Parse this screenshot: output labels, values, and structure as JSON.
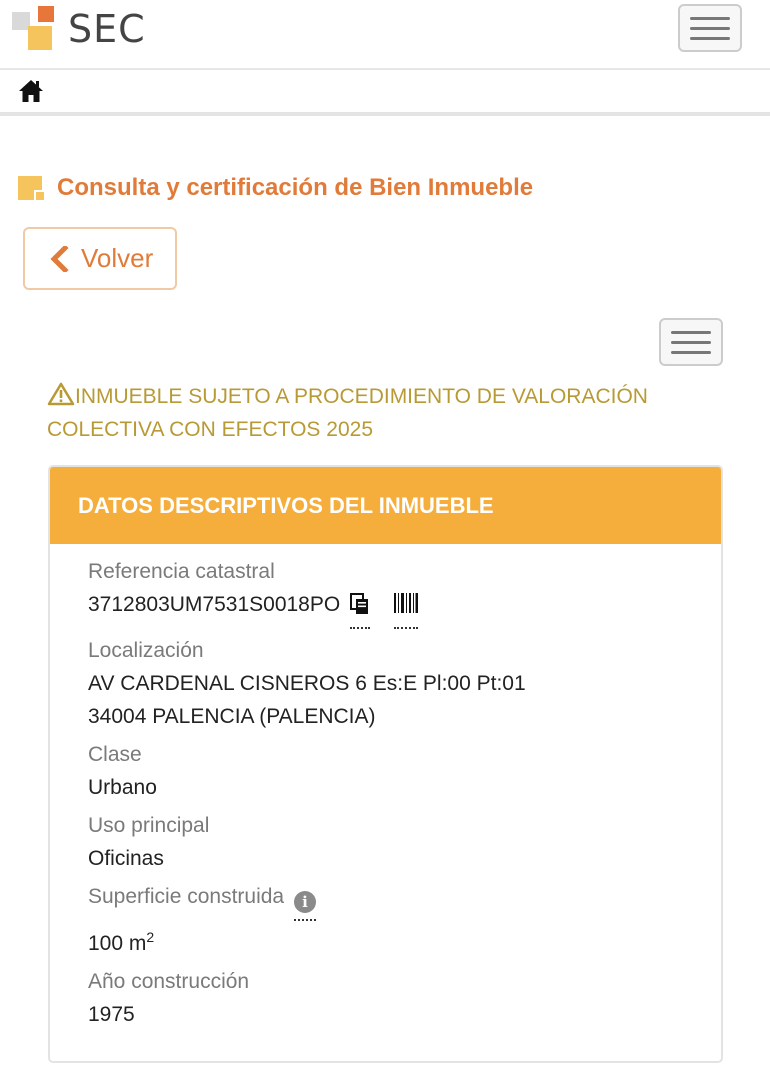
{
  "header": {
    "logo_text": "SEC",
    "menu_icon": "hamburger-icon"
  },
  "breadcrumb": {
    "home_icon": "home-icon"
  },
  "page": {
    "title": "Consulta y certificación de Bien Inmueble",
    "back_label": "Volver"
  },
  "warning": {
    "icon": "warning-triangle-icon",
    "text": "INMUEBLE SUJETO A PROCEDIMIENTO DE VALORACIÓN COLECTIVA CON EFECTOS 2025"
  },
  "panel": {
    "title": "DATOS DESCRIPTIVOS DEL INMUEBLE",
    "fields": {
      "referencia": {
        "label": "Referencia catastral",
        "value": "3712803UM7531S0018PO"
      },
      "localizacion": {
        "label": "Localización",
        "line1": "AV CARDENAL CISNEROS 6 Es:E Pl:00 Pt:01",
        "line2": "34004 PALENCIA (PALENCIA)"
      },
      "clase": {
        "label": "Clase",
        "value": "Urbano"
      },
      "uso": {
        "label": "Uso principal",
        "value": "Oficinas"
      },
      "superficie": {
        "label": "Superficie construida",
        "value": "100 m",
        "unit_sup": "2",
        "info_glyph": "i"
      },
      "anio": {
        "label": "Año construcción",
        "value": "1975"
      }
    }
  },
  "colors": {
    "accent": "#e07b39",
    "panel_header": "#f5ae3c",
    "warning": "#b89a35"
  }
}
